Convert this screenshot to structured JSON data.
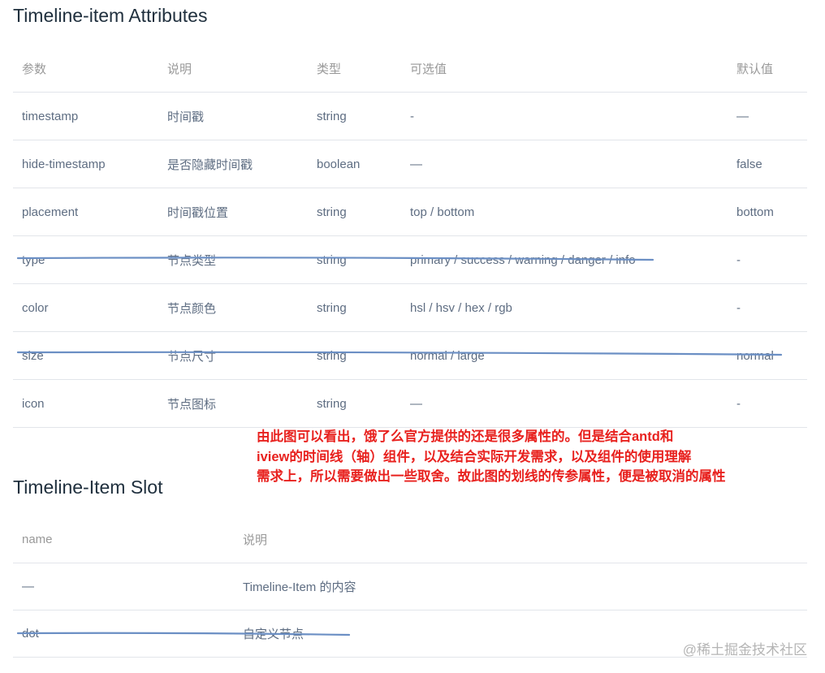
{
  "attributes": {
    "title": "Timeline-item Attributes",
    "headers": [
      "参数",
      "说明",
      "类型",
      "可选值",
      "默认值"
    ],
    "rows": [
      [
        "timestamp",
        "时间戳",
        "string",
        "-",
        "—"
      ],
      [
        "hide-timestamp",
        "是否隐藏时间戳",
        "boolean",
        "—",
        "false"
      ],
      [
        "placement",
        "时间戳位置",
        "string",
        "top / bottom",
        "bottom"
      ],
      [
        "type",
        "节点类型",
        "string",
        "primary / success / warning / danger / info",
        "-"
      ],
      [
        "color",
        "节点颜色",
        "string",
        "hsl / hsv / hex / rgb",
        "-"
      ],
      [
        "size",
        "节点尺寸",
        "string",
        "normal / large",
        "normal"
      ],
      [
        "icon",
        "节点图标",
        "string",
        "—",
        "-"
      ]
    ]
  },
  "annotation": {
    "lines": [
      "由此图可以看出，饿了么官方提供的还是很多属性的。但是结合antd和",
      "iview的时间线（轴）组件，以及结合实际开发需求，以及组件的使用理解",
      "需求上，所以需要做出一些取舍。故此图的划线的传参属性，便是被取消的属性"
    ],
    "color": "#e8211e"
  },
  "slots": {
    "title": "Timeline-Item Slot",
    "headers": [
      "name",
      "说明"
    ],
    "rows": [
      [
        "—",
        "Timeline-Item 的内容"
      ],
      [
        "dot",
        "自定义节点"
      ]
    ]
  },
  "watermark": "@稀土掘金技术社区",
  "colors": {
    "strike_line": "#6b8fc4",
    "border": "#e2e5ea"
  }
}
